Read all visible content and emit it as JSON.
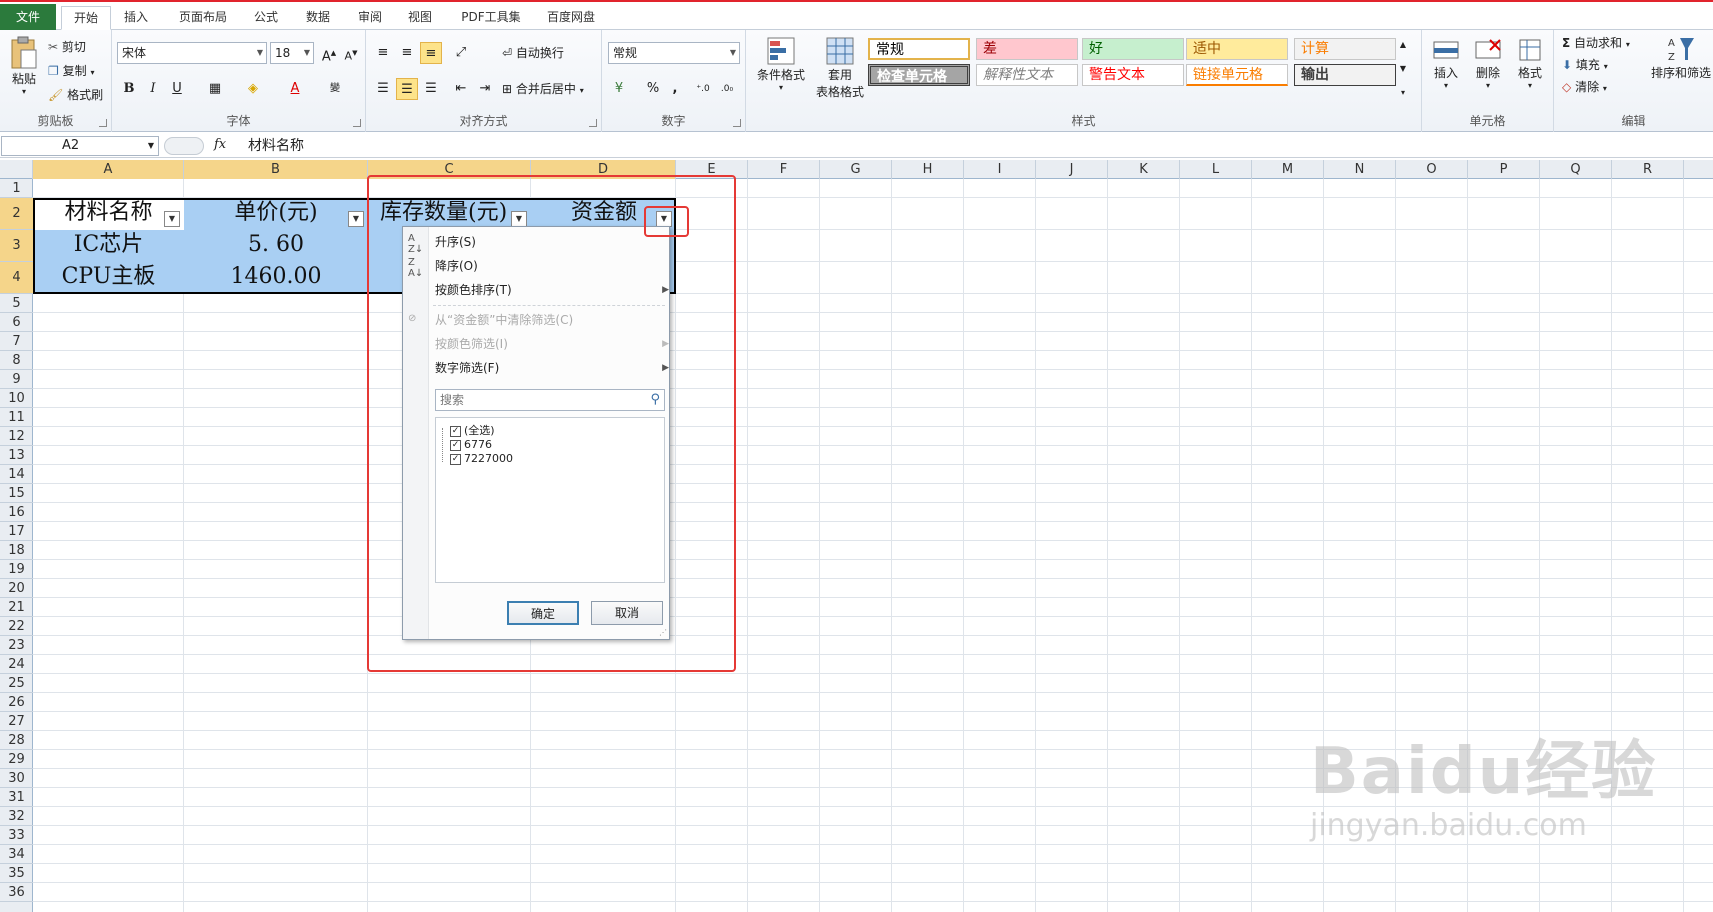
{
  "tabs": [
    {
      "label": "文件",
      "active": false
    },
    {
      "label": "开始",
      "active": true
    },
    {
      "label": "插入",
      "active": false
    },
    {
      "label": "页面布局",
      "active": false
    },
    {
      "label": "公式",
      "active": false
    },
    {
      "label": "数据",
      "active": false
    },
    {
      "label": "审阅",
      "active": false
    },
    {
      "label": "视图",
      "active": false
    },
    {
      "label": "PDF工具集",
      "active": false
    },
    {
      "label": "百度网盘",
      "active": false
    }
  ],
  "ribbon": {
    "clipboard": {
      "paste": "粘贴",
      "cut": "剪切",
      "copy": "复制",
      "format_painter": "格式刷",
      "label": "剪贴板"
    },
    "font": {
      "name": "宋体",
      "size": "18",
      "label": "字体",
      "bold": "B",
      "italic": "I",
      "underline": "U"
    },
    "alignment": {
      "wrap": "自动换行",
      "merge": "合并后居中",
      "label": "对齐方式"
    },
    "number": {
      "format": "常规",
      "percent": "%",
      "comma": ",",
      "label": "数字"
    },
    "styles": {
      "conditional": "条件格式",
      "table_format_1": "套用",
      "table_format_2": "表格格式",
      "cells": [
        {
          "text": "常规",
          "bg": "#ffffff",
          "color": "#000000"
        },
        {
          "text": "差",
          "bg": "#ffc7ce",
          "color": "#9c0006"
        },
        {
          "text": "好",
          "bg": "#c6efce",
          "color": "#006100"
        },
        {
          "text": "适中",
          "bg": "#ffeb9c",
          "color": "#9c5700"
        },
        {
          "text": "计算",
          "bg": "#f2f2f2",
          "color": "#fa7d00"
        },
        {
          "text": "检查单元格",
          "bg": "#a5a5a5",
          "color": "#ffffff"
        },
        {
          "text": "解释性文本",
          "bg": "#ffffff",
          "color": "#7f7f7f"
        },
        {
          "text": "警告文本",
          "bg": "#ffffff",
          "color": "#ff0000"
        },
        {
          "text": "链接单元格",
          "bg": "#ffffff",
          "color": "#fa7d00"
        },
        {
          "text": "输出",
          "bg": "#f2f2f2",
          "color": "#3f3f3f"
        }
      ],
      "label": "样式"
    },
    "cells": {
      "insert": "插入",
      "delete": "删除",
      "format": "格式",
      "label": "单元格"
    },
    "editing": {
      "autosum": "自动求和",
      "fill": "填充",
      "clear": "清除",
      "sort_filter": "排序和筛选",
      "label": "编辑"
    }
  },
  "formula_bar": {
    "name_box": "A2",
    "fx": "fx",
    "value": "材料名称"
  },
  "columns": [
    "A",
    "B",
    "C",
    "D",
    "E",
    "F",
    "G",
    "H",
    "I",
    "J",
    "K",
    "L",
    "M",
    "N",
    "O",
    "P",
    "Q",
    "R"
  ],
  "rows": [
    "1",
    "2",
    "3",
    "4",
    "5",
    "6",
    "7",
    "8",
    "9",
    "10",
    "11",
    "12",
    "13",
    "14",
    "15",
    "16",
    "17",
    "18",
    "19",
    "20",
    "21",
    "22",
    "23",
    "24",
    "25",
    "26",
    "27",
    "28",
    "29",
    "30",
    "31",
    "32",
    "33",
    "34",
    "35",
    "36"
  ],
  "table": {
    "headers": [
      "材料名称",
      "单价(元)",
      "库存数量(元)",
      "资金额"
    ],
    "rows": [
      [
        "IC芯片",
        "5. 60"
      ],
      [
        "CPU主板",
        "1460.00"
      ]
    ]
  },
  "filter_menu": {
    "sort_asc": "升序(S)",
    "sort_desc": "降序(O)",
    "sort_by_color": "按颜色排序(T)",
    "clear_filter": "从“资金额”中清除筛选(C)",
    "filter_by_color": "按颜色筛选(I)",
    "number_filter": "数字筛选(F)",
    "search_placeholder": "搜索",
    "items": [
      {
        "label": "(全选)",
        "checked": true
      },
      {
        "label": "6776",
        "checked": true
      },
      {
        "label": "7227000",
        "checked": true
      }
    ],
    "ok": "确定",
    "cancel": "取消"
  },
  "watermark": {
    "brand": "Baidu经验",
    "url": "jingyan.baidu.com"
  }
}
